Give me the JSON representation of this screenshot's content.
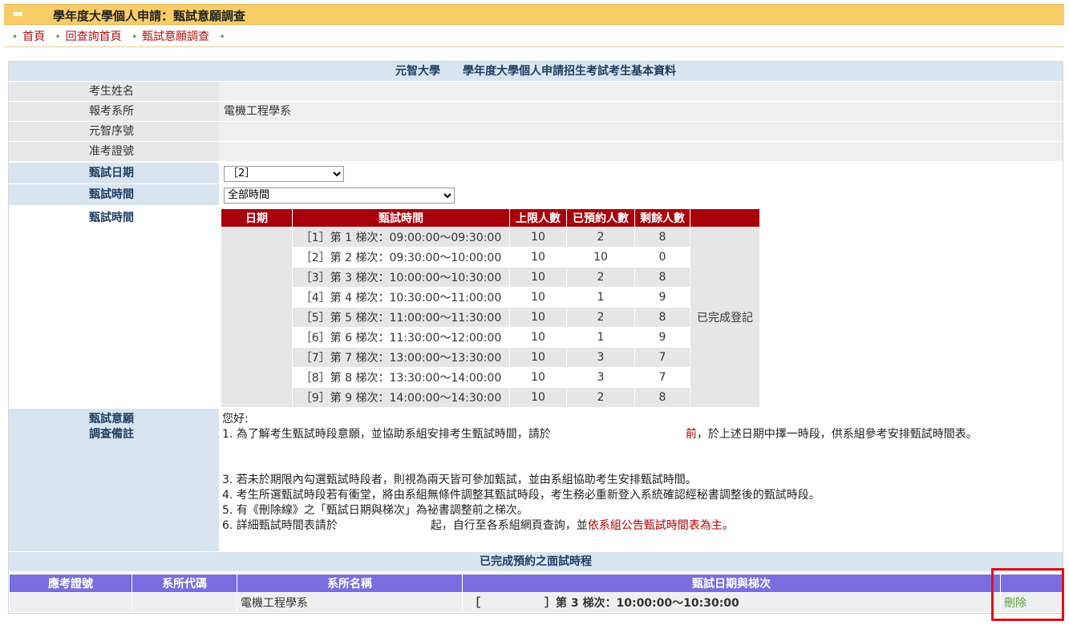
{
  "header": {
    "title": "學年度大學個人申請：甄試意願調查"
  },
  "breadcrumb": {
    "items": [
      "首頁",
      "回查詢首頁",
      "甄試意願調查"
    ]
  },
  "basic_info": {
    "title": "元智大學　　學年度大學個人申請招生考試考生基本資料",
    "fields": [
      {
        "label": "考生姓名",
        "value": ""
      },
      {
        "label": "報考系所",
        "value": "電機工程學系"
      },
      {
        "label": "元智序號",
        "value": ""
      },
      {
        "label": "准考證號",
        "value": ""
      }
    ],
    "interview_date_label": "甄試日期",
    "interview_date_value": "［2］",
    "interview_time_label": "甄試時間",
    "interview_time_value": "全部時間",
    "schedule_label": "甄試時間"
  },
  "schedule": {
    "headers": [
      "日期",
      "甄試時間",
      "上限人數",
      "已預約人數",
      "剩餘人數"
    ],
    "rows": [
      {
        "slot": "［1］第 1 梯次：09:00:00～09:30:00",
        "limit": "10",
        "booked": "2",
        "remain": "8"
      },
      {
        "slot": "［2］第 2 梯次：09:30:00～10:00:00",
        "limit": "10",
        "booked": "10",
        "remain": "0"
      },
      {
        "slot": "［3］第 3 梯次：10:00:00～10:30:00",
        "limit": "10",
        "booked": "2",
        "remain": "8"
      },
      {
        "slot": "［4］第 4 梯次：10:30:00～11:00:00",
        "limit": "10",
        "booked": "1",
        "remain": "9"
      },
      {
        "slot": "［5］第 5 梯次：11:00:00～11:30:00",
        "limit": "10",
        "booked": "2",
        "remain": "8"
      },
      {
        "slot": "［6］第 6 梯次：11:30:00～12:00:00",
        "limit": "10",
        "booked": "1",
        "remain": "9"
      },
      {
        "slot": "［7］第 7 梯次：13:00:00～13:30:00",
        "limit": "10",
        "booked": "3",
        "remain": "7"
      },
      {
        "slot": "［8］第 8 梯次：13:30:00～14:00:00",
        "limit": "10",
        "booked": "3",
        "remain": "7"
      },
      {
        "slot": "［9］第 9 梯次：14:00:00～14:30:00",
        "limit": "10",
        "booked": "2",
        "remain": "8"
      }
    ],
    "status": "已完成登記"
  },
  "notes": {
    "label_line1": "甄試意願",
    "label_line2": "調查備註",
    "greeting": "您好:",
    "n1_a": "1. 為了解考生甄試時段意願，並協助系組安排考生甄試時間，請於",
    "n1_red": "前",
    "n1_b": "，於上述日期中擇一時段，供系組參考安排甄試時間表。",
    "n3": "3. 若未於期限內勾選甄試時段者，則視為兩天皆可參加甄試，並由系組協助考生安排甄試時間。",
    "n4": "4. 考生所選甄試時段若有衝堂，將由系組無條件調整其甄試時段，考生務必重新登入系統確認經秘書調整後的甄試時段。",
    "n5": "5. 有《刪除線》之「甄試日期與梯次」為祕書調整前之梯次。",
    "n6_a": "6. 詳細甄試時間表請於",
    "n6_b": "起，自行至各系組網頁查詢，並",
    "n6_red": "依系組公告甄試時間表為主",
    "n6_c": "。"
  },
  "completed": {
    "title": "已完成預約之面試時程",
    "headers": [
      "應考證號",
      "系所代碼",
      "系所名稱",
      "甄試日期與梯次",
      ""
    ],
    "row": {
      "exam_no": "",
      "dept_code": "",
      "dept_name": "電機工程學系",
      "slot_open": "［",
      "slot_rest": "］第 3 梯次：10:00:00～10:30:00",
      "action": "刪除"
    }
  }
}
